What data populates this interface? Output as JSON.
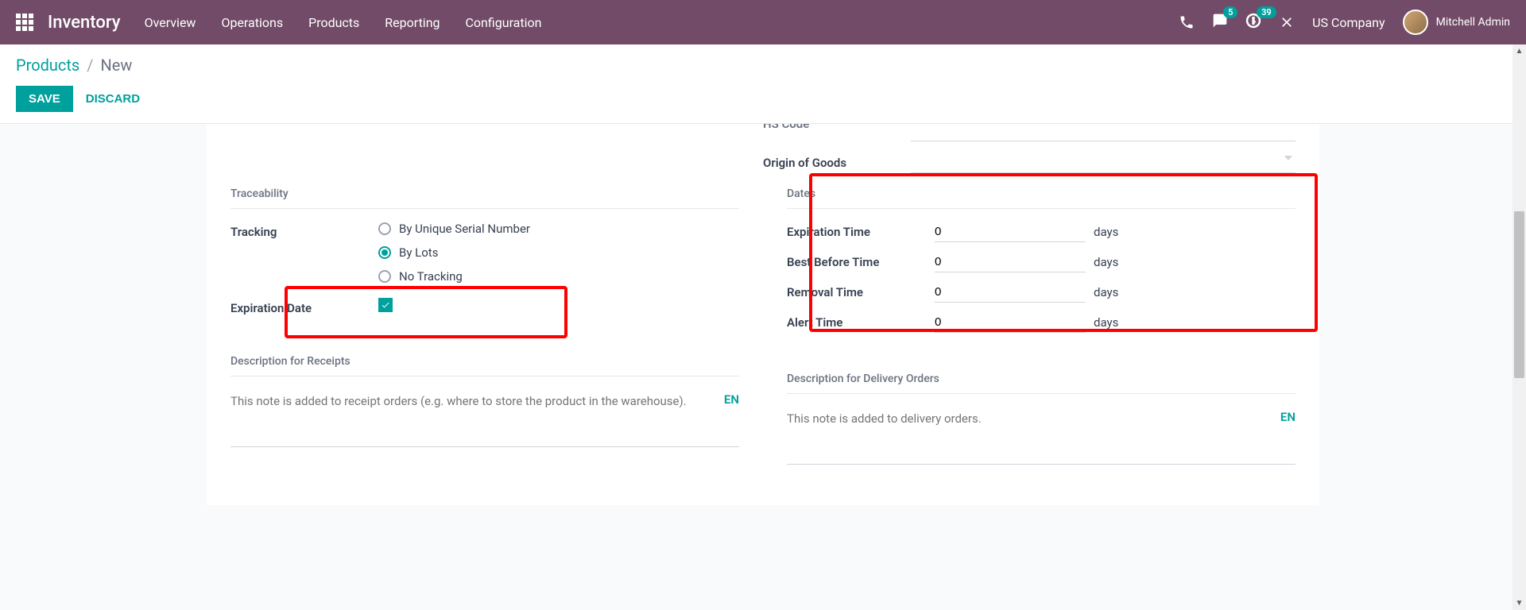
{
  "nav": {
    "brand": "Inventory",
    "menu": [
      "Overview",
      "Operations",
      "Products",
      "Reporting",
      "Configuration"
    ],
    "messaging_badge": "5",
    "activity_badge": "39",
    "company": "US Company",
    "user": "Mitchell Admin"
  },
  "breadcrumb": {
    "root": "Products",
    "sep": "/",
    "current": "New"
  },
  "buttons": {
    "save": "SAVE",
    "discard": "DISCARD"
  },
  "truncated": {
    "hs_code_label": "HS Code",
    "origin_label": "Origin of Goods"
  },
  "traceability": {
    "section": "Traceability",
    "tracking_label": "Tracking",
    "options": {
      "serial": "By Unique Serial Number",
      "lots": "By Lots",
      "none": "No Tracking"
    },
    "expiration_label": "Expiration Date"
  },
  "dates": {
    "section": "Dates",
    "unit": "days",
    "rows": {
      "expiration": {
        "label": "Expiration Time",
        "value": "0"
      },
      "best_before": {
        "label": "Best Before Time",
        "value": "0"
      },
      "removal": {
        "label": "Removal Time",
        "value": "0"
      },
      "alert": {
        "label": "Alert Time",
        "value": "0"
      }
    }
  },
  "descriptions": {
    "receipts": {
      "title": "Description for Receipts",
      "placeholder": "This note is added to receipt orders (e.g. where to store the product in the warehouse).",
      "lang": "EN"
    },
    "delivery": {
      "title": "Description for Delivery Orders",
      "placeholder": "This note is added to delivery orders.",
      "lang": "EN"
    }
  }
}
